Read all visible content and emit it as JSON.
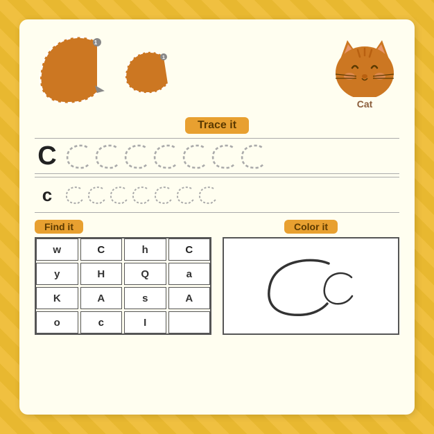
{
  "background": {
    "color": "#f0c040",
    "stripe_color": "#e8b830"
  },
  "top": {
    "big_letter": "C",
    "small_letter": "c",
    "animal_name": "Cat"
  },
  "trace_section": {
    "badge_label": "Trace it",
    "uppercase_example": "C",
    "lowercase_example": "c",
    "dashed_count_upper": 7,
    "dashed_count_lower": 7
  },
  "find_it": {
    "badge_label": "Find it",
    "grid": [
      [
        "w",
        "C",
        "h",
        "C",
        "y"
      ],
      [
        "H",
        "Q",
        "a",
        "K",
        "A"
      ],
      [
        "s",
        "A",
        "o",
        "c",
        "I"
      ]
    ]
  },
  "color_it": {
    "badge_label": "Color it"
  }
}
